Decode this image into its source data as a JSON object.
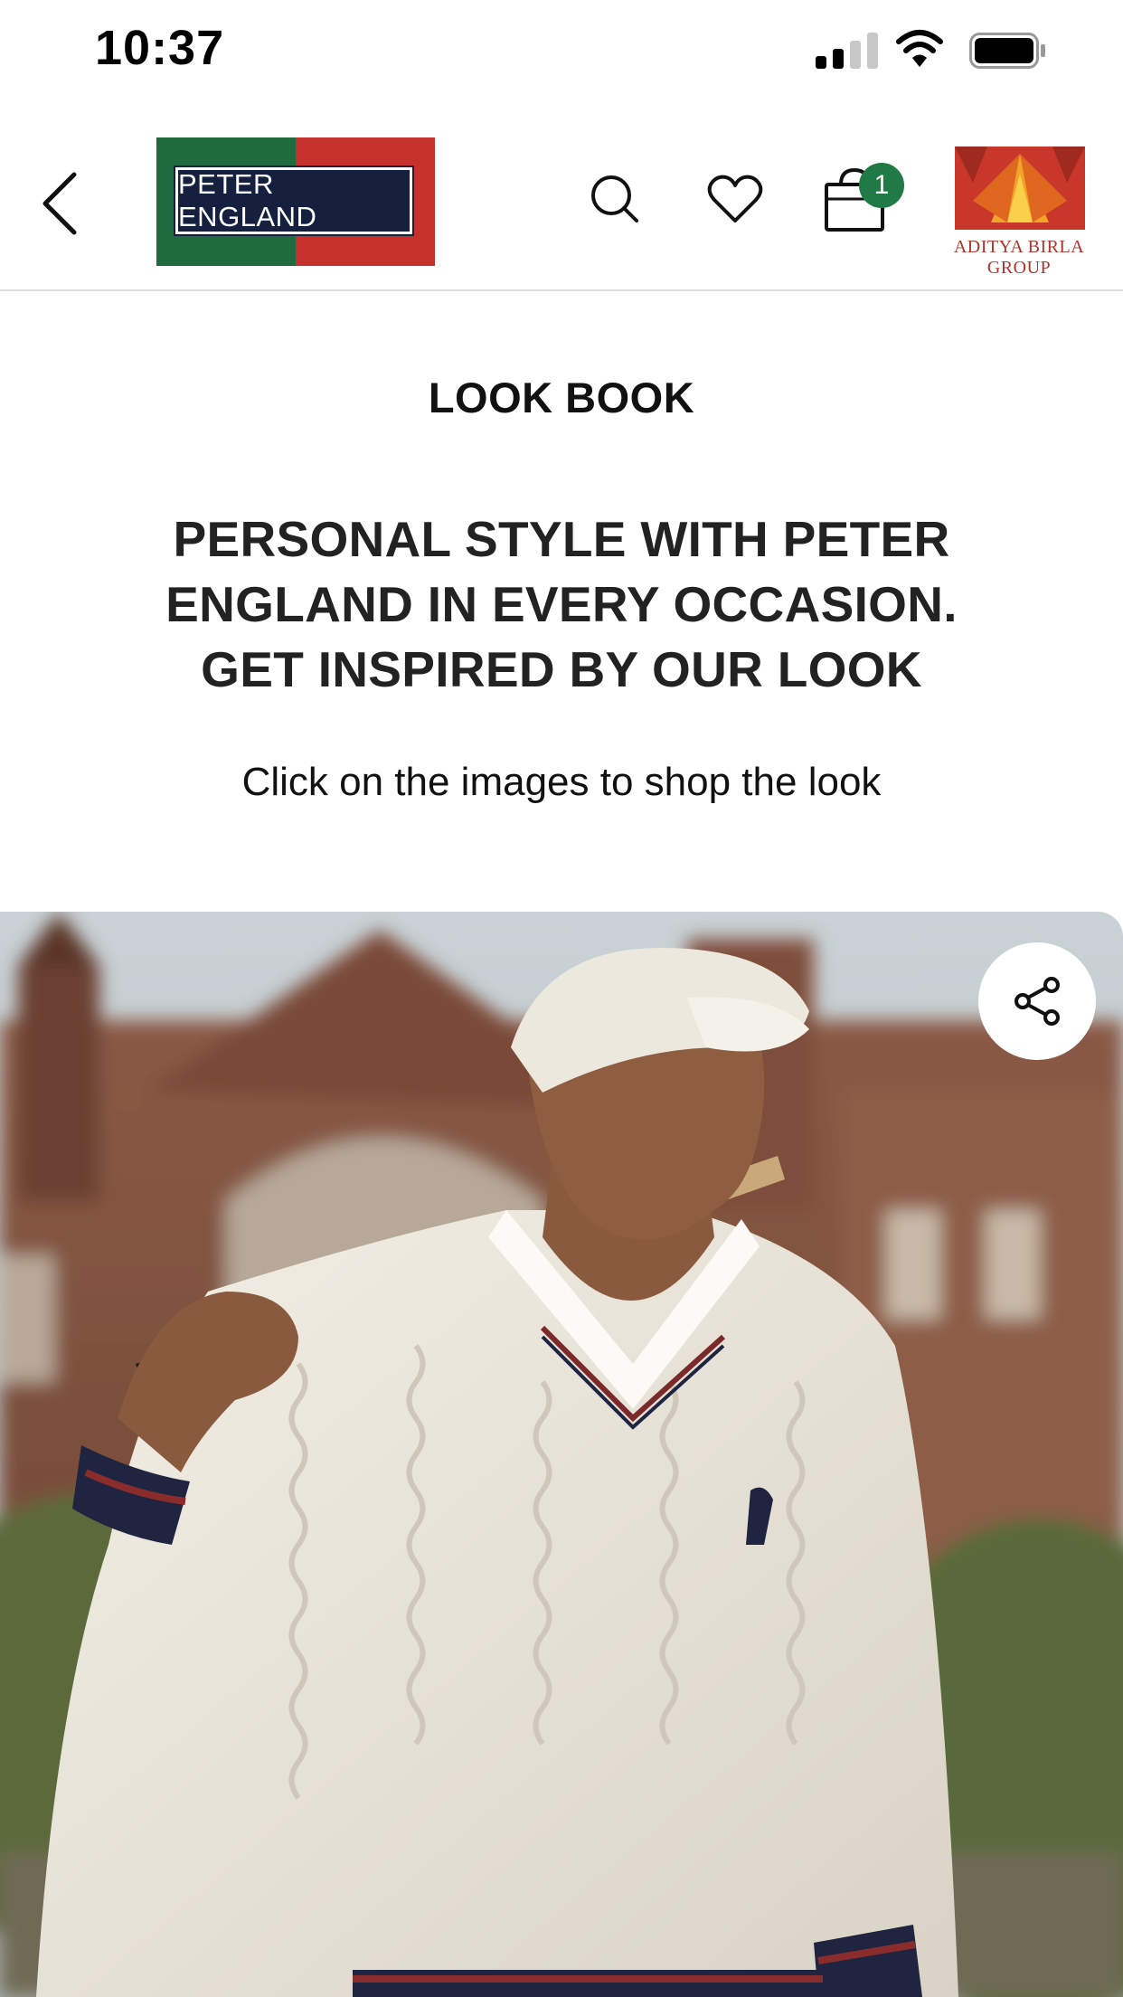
{
  "status_bar": {
    "time": "10:37"
  },
  "header": {
    "back_icon": "chevron-left-icon",
    "brand_logo_text": "PETER ENGLAND",
    "search_icon": "search-icon",
    "wishlist_icon": "heart-icon",
    "bag_icon": "shopping-bag-icon",
    "bag_count": "1",
    "group_logo_text": "ADITYA BIRLA GROUP"
  },
  "content": {
    "section_title": "LOOK BOOK",
    "headline": "PERSONAL STYLE WITH PETER ENGLAND IN EVERY OCCASION. GET INSPIRED BY OUR LOOK",
    "subtext": "Click on the images to shop the look",
    "share_icon": "share-icon"
  },
  "colors": {
    "brand_green": "#1f6a3e",
    "brand_red": "#c6302d",
    "brand_navy": "#15203f",
    "badge_green": "#1f7a45",
    "group_red": "#b0342a"
  }
}
